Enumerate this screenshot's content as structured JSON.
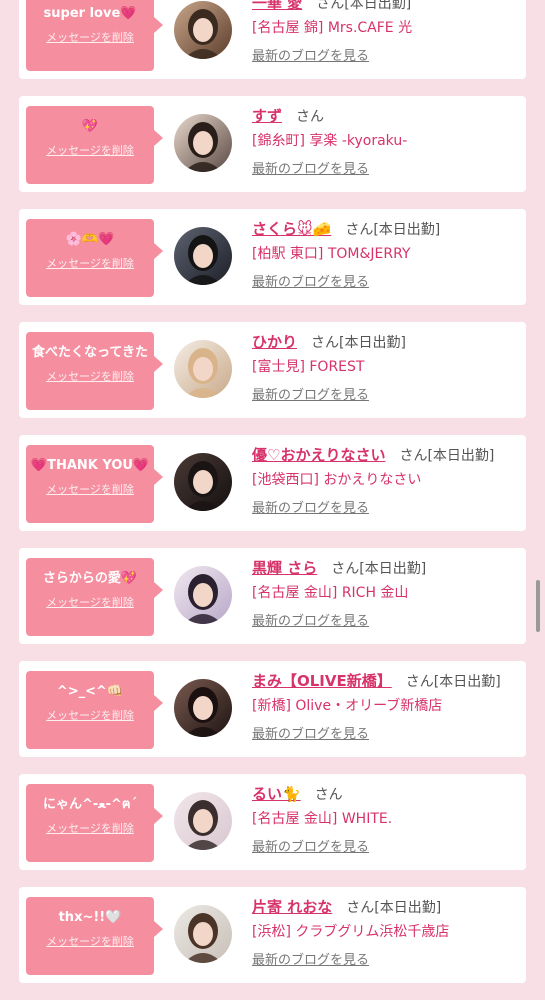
{
  "delete_label": "メッセージを削除",
  "blog_label": "最新のブログを見る",
  "honorific": "さん",
  "colors": {
    "accent": "#d7336a",
    "bubble": "#f58fa0",
    "page_bg": "#f7dfe5"
  },
  "items": [
    {
      "message": "super love💗",
      "name": "一華 愛",
      "status": "[本日出勤]",
      "shop": "[名古屋 錦] Mrs.CAFE 光",
      "avatar": {
        "bg1": "#c9a68a",
        "bg2": "#5b3d2c",
        "hair": "#3b2a1f"
      }
    },
    {
      "message": "💖",
      "name": "すず",
      "status": "",
      "shop": "[錦糸町] 享楽 -kyoraku-",
      "avatar": {
        "bg1": "#e8d8cc",
        "bg2": "#5a4a44",
        "hair": "#2a1e1a"
      }
    },
    {
      "message": "🌸🫶💗",
      "name": "さくら🐭🧀",
      "status": "[本日出勤]",
      "shop": "[柏駅 東口] TOM&JERRY",
      "avatar": {
        "bg1": "#5d6270",
        "bg2": "#1d2028",
        "hair": "#141414"
      }
    },
    {
      "message": "食べたくなってきた",
      "name": "ひかり",
      "status": "[本日出勤]",
      "shop": "[富士見] FOREST",
      "avatar": {
        "bg1": "#f4ede4",
        "bg2": "#c9a98a",
        "hair": "#d9b48a"
      }
    },
    {
      "message": "💗THANK YOU💗",
      "name": "優♡おかえりなさい",
      "status": "[本日出勤]",
      "shop": "[池袋西口] おかえりなさい",
      "avatar": {
        "bg1": "#4a3a36",
        "bg2": "#141010",
        "hair": "#1a1414"
      }
    },
    {
      "message": "さらからの愛💖",
      "name": "黒輝 さら",
      "status": "[本日出勤]",
      "shop": "[名古屋 金山] RICH 金山",
      "avatar": {
        "bg1": "#f0e8f0",
        "bg2": "#b8a8c8",
        "hair": "#2a2030"
      }
    },
    {
      "message": "^>_<^👊🏻",
      "name": "まみ【OLIVE新橋】",
      "status": "[本日出勤]",
      "shop": "[新橋] Olive・オリーブ新橋店",
      "avatar": {
        "bg1": "#7a5a50",
        "bg2": "#1e1412",
        "hair": "#1a1010"
      }
    },
    {
      "message": "にゃん^-ﻌ-^ฅ´",
      "name": "るい🐈",
      "status": "",
      "shop": "[名古屋 金山] WHITE.",
      "avatar": {
        "bg1": "#f2e6ea",
        "bg2": "#d8c8d0",
        "hair": "#3a2e2e"
      }
    },
    {
      "message": "thx~!!🤍",
      "name": "片寄 れおな",
      "status": "[本日出勤]",
      "shop": "[浜松] クラブグリム浜松千歳店",
      "avatar": {
        "bg1": "#ece8e4",
        "bg2": "#c8c0b8",
        "hair": "#4a3428"
      }
    }
  ]
}
